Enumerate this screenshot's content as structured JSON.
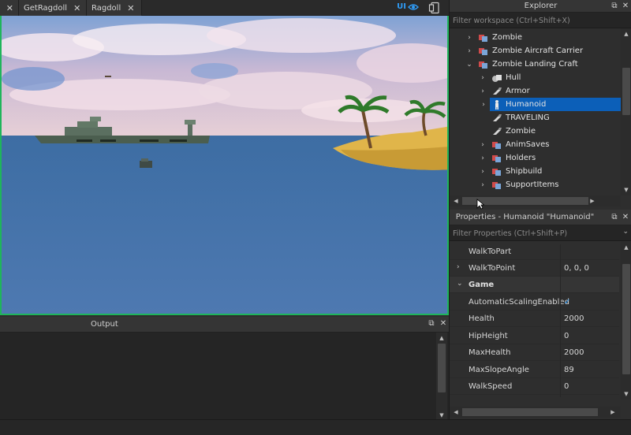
{
  "tabs": [
    {
      "label": ""
    },
    {
      "label": "GetRagdoll"
    },
    {
      "label": "Ragdoll"
    }
  ],
  "toolbar": {
    "ui_label": "UI"
  },
  "explorer": {
    "title": "Explorer",
    "filter_placeholder": "Filter workspace (Ctrl+Shift+X)",
    "items": [
      {
        "label": "Zombie",
        "icon": "model-icon",
        "expanded": false
      },
      {
        "label": "Zombie Aircraft Carrier",
        "icon": "model-icon",
        "expanded": false
      },
      {
        "label": "Zombie Landing Craft",
        "icon": "model-icon",
        "expanded": true
      },
      {
        "label": "Hull",
        "icon": "union-icon",
        "expanded": false
      },
      {
        "label": "Armor",
        "icon": "part-icon",
        "expanded": false
      },
      {
        "label": "Humanoid",
        "icon": "humanoid-icon",
        "expanded": false,
        "selected": true
      },
      {
        "label": "TRAVELING",
        "icon": "part-icon"
      },
      {
        "label": "Zombie",
        "icon": "part-icon"
      },
      {
        "label": "AnimSaves",
        "icon": "model-icon",
        "expanded": false
      },
      {
        "label": "Holders",
        "icon": "model-icon",
        "expanded": false
      },
      {
        "label": "Shipbuild",
        "icon": "model-icon",
        "expanded": false
      },
      {
        "label": "SupportItems",
        "icon": "model-icon",
        "expanded": false
      }
    ]
  },
  "properties": {
    "title": "Properties - Humanoid \"Humanoid\"",
    "filter_placeholder": "Filter Properties (Ctrl+Shift+P)",
    "rows": [
      {
        "name": "WalkToPart",
        "value": ""
      },
      {
        "name": "WalkToPoint",
        "value": "0, 0, 0"
      },
      {
        "name": "Game",
        "value": "",
        "category": true
      },
      {
        "name": "AutomaticScalingEnabled",
        "value": "✓"
      },
      {
        "name": "Health",
        "value": "2000"
      },
      {
        "name": "HipHeight",
        "value": "0"
      },
      {
        "name": "MaxHealth",
        "value": "2000"
      },
      {
        "name": "MaxSlopeAngle",
        "value": "89"
      },
      {
        "name": "WalkSpeed",
        "value": "0"
      }
    ]
  },
  "output": {
    "title": "Output"
  },
  "colors": {
    "selection": "#0c5fb8",
    "viewport_border": "#1fb55b",
    "accent": "#2f9bf5"
  }
}
